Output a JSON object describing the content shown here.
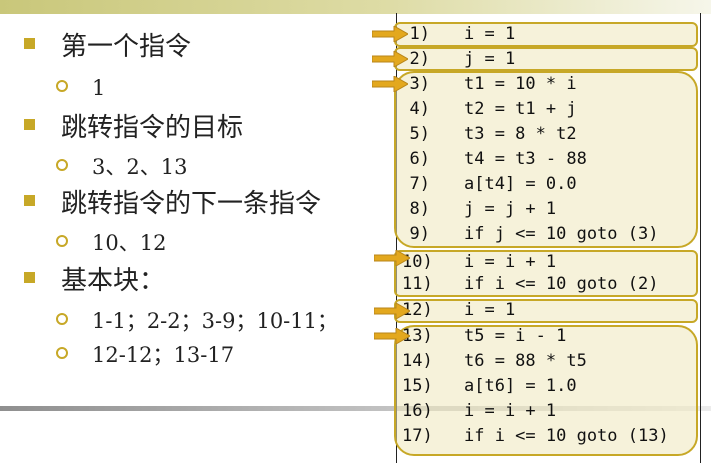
{
  "bullets": [
    {
      "text": "第一个指令",
      "sub": [
        "1"
      ]
    },
    {
      "text": "跳转指令的目标",
      "sub": [
        "3、2、13"
      ]
    },
    {
      "text": "跳转指令的下一条指令",
      "sub": [
        "10、12"
      ]
    },
    {
      "text": "基本块：",
      "sub": [
        "1-1；2-2；3-9；10-11；",
        "12-12；13-17"
      ]
    }
  ],
  "code": [
    {
      "n": "1)",
      "t": "i = 1"
    },
    {
      "n": "2)",
      "t": "j = 1"
    },
    {
      "n": "3)",
      "t": "t1 = 10 * i"
    },
    {
      "n": "4)",
      "t": "t2 = t1 + j"
    },
    {
      "n": "5)",
      "t": "t3 = 8 * t2"
    },
    {
      "n": "6)",
      "t": "t4 = t3 - 88"
    },
    {
      "n": "7)",
      "t": "a[t4] = 0.0"
    },
    {
      "n": "8)",
      "t": "j = j + 1"
    },
    {
      "n": "9)",
      "t": "if j <= 10 goto (3)"
    },
    {
      "n": "10)",
      "t": "i = i + 1"
    },
    {
      "n": "11)",
      "t": "if i <= 10 goto (2)"
    },
    {
      "n": "12)",
      "t": "i = 1"
    },
    {
      "n": "13)",
      "t": "t5 = i - 1"
    },
    {
      "n": "14)",
      "t": "t6 = 88 * t5"
    },
    {
      "n": "15)",
      "t": "a[t6] = 1.0"
    },
    {
      "n": "16)",
      "t": "i = i + 1"
    },
    {
      "n": "17)",
      "t": "if i <= 10 goto (13)"
    }
  ],
  "colors": {
    "accent": "#c7a827",
    "block_fill": "#eee8bc",
    "arrow": "#e3a81e"
  },
  "icons": {
    "leader_marker": "arrow-right-icon",
    "bullet_l1": "square-bullet-icon",
    "bullet_l2": "circle-bullet-icon"
  }
}
